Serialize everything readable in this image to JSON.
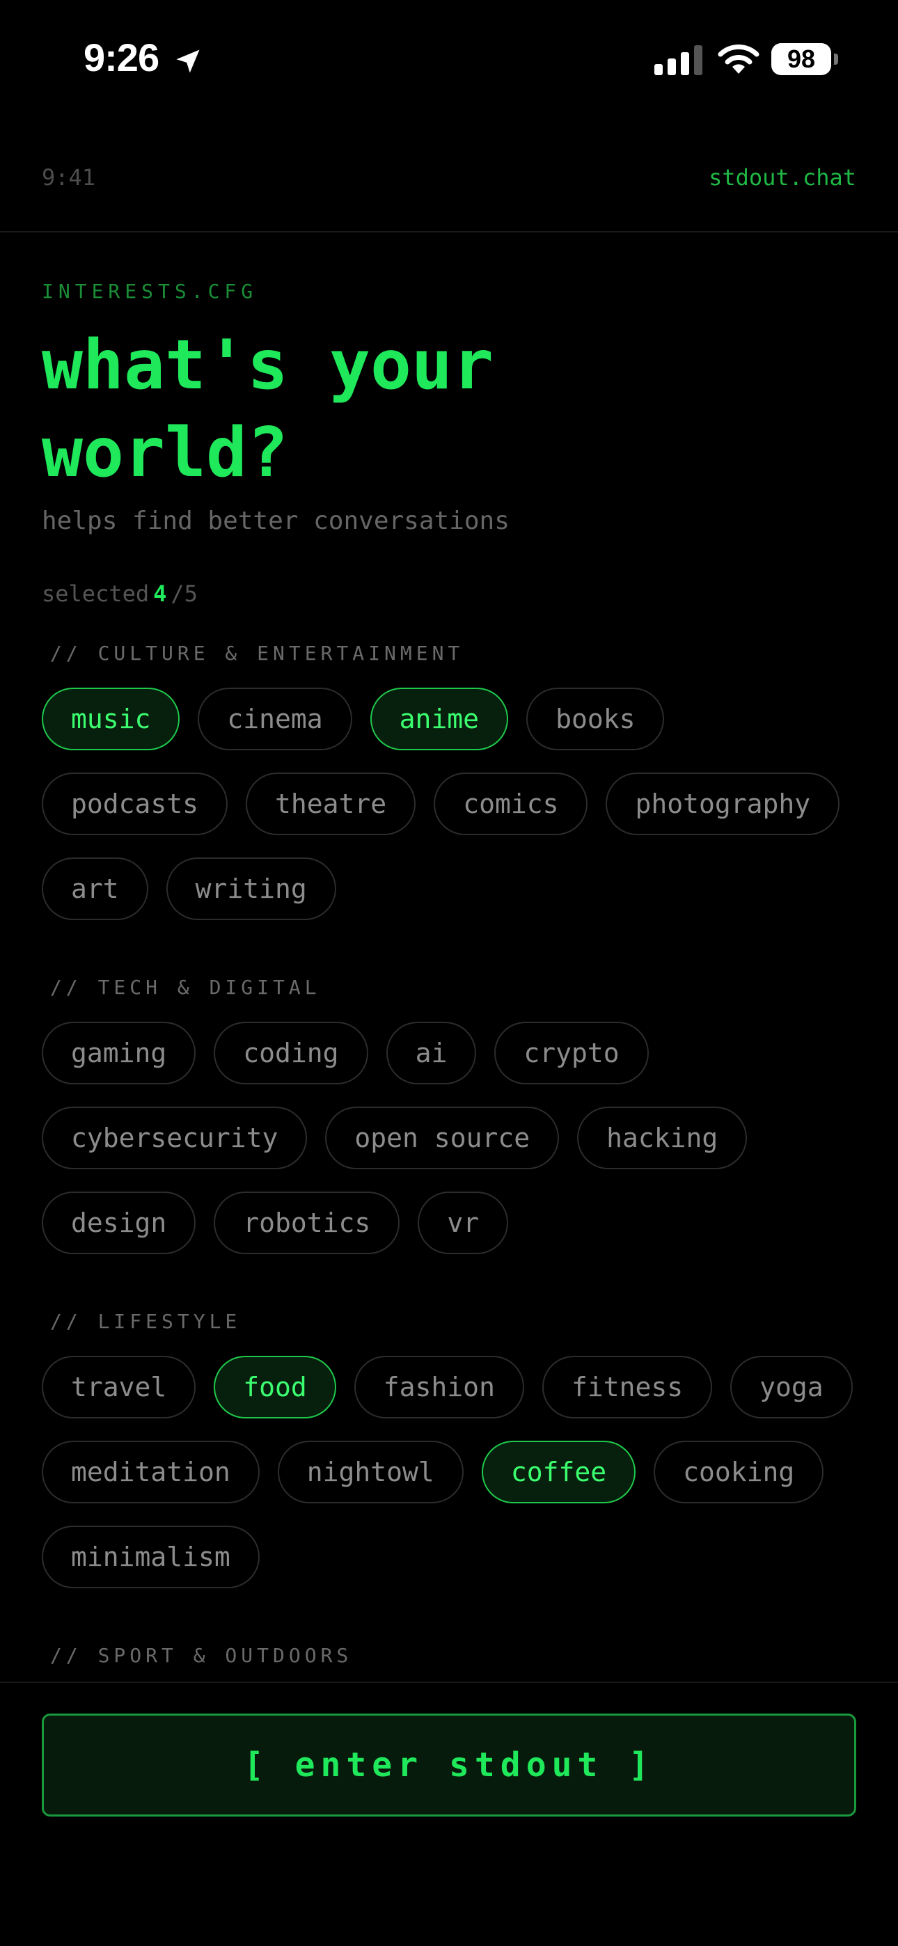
{
  "status_bar": {
    "time": "9:26",
    "battery": "98"
  },
  "app_header": {
    "clock": "9:41",
    "brand": "stdout.chat"
  },
  "hero": {
    "tag": "INTERESTS.CFG",
    "title": "what's your world?",
    "subtitle": "helps find better conversations"
  },
  "counter": {
    "label": "selected",
    "count": "4",
    "max": "/5"
  },
  "categories": [
    {
      "title": "// CULTURE & ENTERTAINMENT",
      "chips": [
        {
          "label": "music",
          "selected": true
        },
        {
          "label": "cinema",
          "selected": false
        },
        {
          "label": "anime",
          "selected": true
        },
        {
          "label": "books",
          "selected": false
        },
        {
          "label": "podcasts",
          "selected": false
        },
        {
          "label": "theatre",
          "selected": false
        },
        {
          "label": "comics",
          "selected": false
        },
        {
          "label": "photography",
          "selected": false
        },
        {
          "label": "art",
          "selected": false
        },
        {
          "label": "writing",
          "selected": false
        }
      ]
    },
    {
      "title": "// TECH & DIGITAL",
      "chips": [
        {
          "label": "gaming",
          "selected": false
        },
        {
          "label": "coding",
          "selected": false
        },
        {
          "label": "ai",
          "selected": false
        },
        {
          "label": "crypto",
          "selected": false
        },
        {
          "label": "cybersecurity",
          "selected": false
        },
        {
          "label": "open source",
          "selected": false
        },
        {
          "label": "hacking",
          "selected": false
        },
        {
          "label": "design",
          "selected": false
        },
        {
          "label": "robotics",
          "selected": false
        },
        {
          "label": "vr",
          "selected": false
        }
      ]
    },
    {
      "title": "// LIFESTYLE",
      "chips": [
        {
          "label": "travel",
          "selected": false
        },
        {
          "label": "food",
          "selected": true
        },
        {
          "label": "fashion",
          "selected": false
        },
        {
          "label": "fitness",
          "selected": false
        },
        {
          "label": "yoga",
          "selected": false
        },
        {
          "label": "meditation",
          "selected": false
        },
        {
          "label": "nightowl",
          "selected": false
        },
        {
          "label": "coffee",
          "selected": true
        },
        {
          "label": "cooking",
          "selected": false
        },
        {
          "label": "minimalism",
          "selected": false
        }
      ]
    },
    {
      "title": "// SPORT & OUTDOORS",
      "chips": []
    }
  ],
  "footer": {
    "button_label": "[ enter stdout ]"
  },
  "colors": {
    "accent": "#1fe85a",
    "background": "#000000",
    "chip_border": "#2c2c2c"
  },
  "icons": {
    "location": "location-arrow-icon",
    "signal": "cellular-signal-icon",
    "wifi": "wifi-icon",
    "battery": "battery-icon"
  }
}
